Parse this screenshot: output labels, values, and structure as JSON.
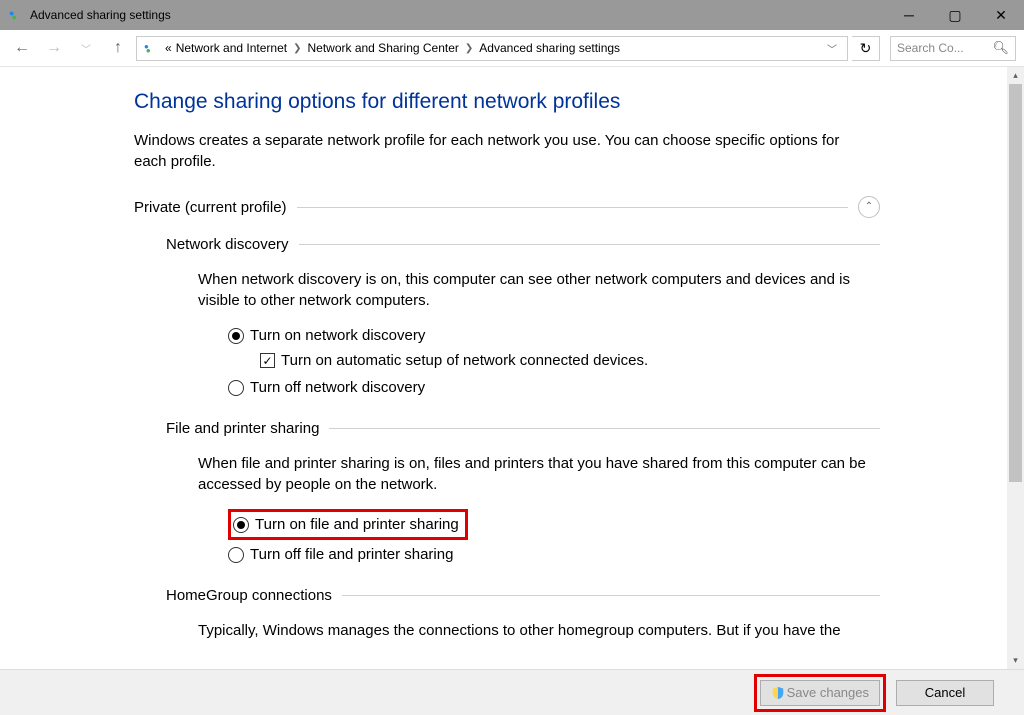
{
  "window": {
    "title": "Advanced sharing settings"
  },
  "breadcrumb": {
    "prefix": "«",
    "items": [
      "Network and Internet",
      "Network and Sharing Center",
      "Advanced sharing settings"
    ]
  },
  "search": {
    "placeholder": "Search Co..."
  },
  "page": {
    "heading": "Change sharing options for different network profiles",
    "intro": "Windows creates a separate network profile for each network you use. You can choose specific options for each profile."
  },
  "profile": {
    "label": "Private (current profile)"
  },
  "network_discovery": {
    "heading": "Network discovery",
    "desc": "When network discovery is on, this computer can see other network computers and devices and is visible to other network computers.",
    "opt_on": "Turn on network discovery",
    "auto_setup": "Turn on automatic setup of network connected devices.",
    "opt_off": "Turn off network discovery"
  },
  "file_printer": {
    "heading": "File and printer sharing",
    "desc": "When file and printer sharing is on, files and printers that you have shared from this computer can be accessed by people on the network.",
    "opt_on": "Turn on file and printer sharing",
    "opt_off": "Turn off file and printer sharing"
  },
  "homegroup": {
    "heading": "HomeGroup connections",
    "desc": "Typically, Windows manages the connections to other homegroup computers. But if you have the"
  },
  "buttons": {
    "save": "Save changes",
    "cancel": "Cancel"
  }
}
